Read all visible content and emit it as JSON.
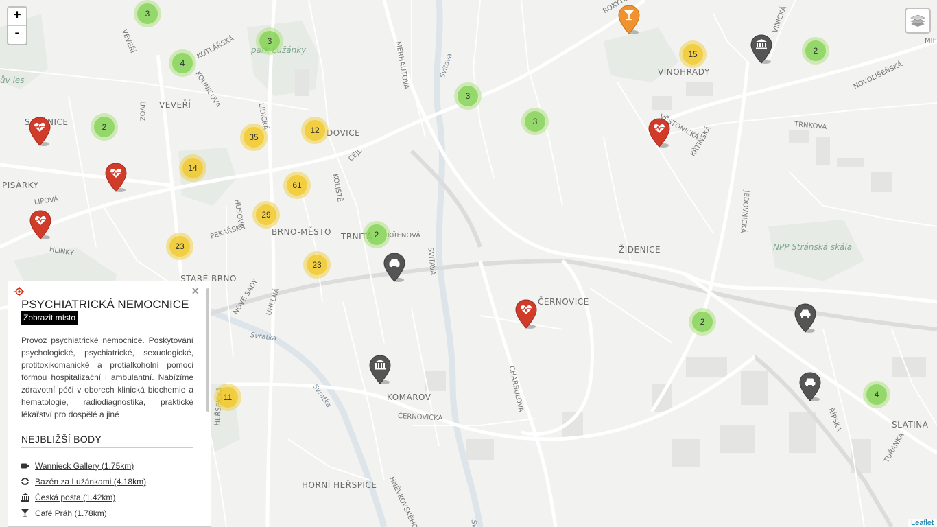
{
  "map": {
    "places": [
      {
        "id": "veveri",
        "text": "VEVEŘÍ"
      },
      {
        "id": "park-luzanky",
        "text": "park Lužánky"
      },
      {
        "id": "vinohrady",
        "text": "VINOHRADY"
      },
      {
        "id": "stranice",
        "text": "STRÁNICE"
      },
      {
        "id": "pisarky",
        "text": "PISÁRKY"
      },
      {
        "id": "brno-mesto",
        "text": "BRNO-MĚSTO"
      },
      {
        "id": "trnita",
        "text": "TRNITÁ"
      },
      {
        "id": "zidenice",
        "text": "ŽIDENICE"
      },
      {
        "id": "npp",
        "text": "NPP Stránská skála"
      },
      {
        "id": "stare-brno",
        "text": "STARÉ BRNO"
      },
      {
        "id": "cernovice",
        "text": "ČERNOVICE"
      },
      {
        "id": "komarov",
        "text": "KOMÁROV"
      },
      {
        "id": "slatina",
        "text": "SLATINA"
      },
      {
        "id": "horni-herspice",
        "text": "HORNÍ HEŘSPICE"
      },
      {
        "id": "zabovresky-fragment",
        "text": "ův les"
      },
      {
        "id": "zidovice-fragment",
        "text": "DOVICE"
      }
    ],
    "streets": [
      {
        "id": "veveri-st",
        "text": "VEVEŘÍ"
      },
      {
        "id": "kotlarska",
        "text": "KOTLÁŘSKÁ"
      },
      {
        "id": "kounicova",
        "text": "KOUNICOVA"
      },
      {
        "id": "udolni",
        "text": "ÚVOZ"
      },
      {
        "id": "lidicka",
        "text": "LIDICKÁ"
      },
      {
        "id": "merhautova",
        "text": "MERHAUTOVA"
      },
      {
        "id": "cejl",
        "text": "CEJL"
      },
      {
        "id": "koliste",
        "text": "KOLIŠTĚ"
      },
      {
        "id": "husova",
        "text": "HUSOVA"
      },
      {
        "id": "pekarska",
        "text": "PEKAŘSKÁ"
      },
      {
        "id": "lipova",
        "text": "LIPOVÁ"
      },
      {
        "id": "hlinky",
        "text": "HLINKY"
      },
      {
        "id": "krenova",
        "text": "KŘENOVÁ"
      },
      {
        "id": "uhelna",
        "text": "UHELNÁ"
      },
      {
        "id": "nove-sady",
        "text": "NOVÉ SADY"
      },
      {
        "id": "vestonicka",
        "text": "VĚSTONICKÁ"
      },
      {
        "id": "krtinska",
        "text": "KŘTINSKÁ"
      },
      {
        "id": "trnkova",
        "text": "TRNKOVA"
      },
      {
        "id": "jedovnicka",
        "text": "JEDOVNICKÁ"
      },
      {
        "id": "novolisenska",
        "text": "NOVOLÍŠEŇSKÁ"
      },
      {
        "id": "charbulova",
        "text": "CHARBULOVA"
      },
      {
        "id": "cernovicka",
        "text": "ČERNOVICKÁ"
      },
      {
        "id": "ripska",
        "text": "ŘÍPSKÁ"
      },
      {
        "id": "turanka",
        "text": "TUŘANKA"
      },
      {
        "id": "herspicka",
        "text": "HEŘSPICKÁ"
      },
      {
        "id": "hnevkovskeho",
        "text": "HNĚVKOVSKÉHO"
      },
      {
        "id": "rokytova",
        "text": "ROKYTOVA"
      },
      {
        "id": "vinohradska-fragment",
        "text": "VINICKÁ"
      },
      {
        "id": "mif-fragment",
        "text": "MIF"
      },
      {
        "id": "vranovska",
        "text": "SVITAVA"
      }
    ],
    "rivers": [
      {
        "id": "svitava-1",
        "text": "Svitava"
      },
      {
        "id": "svitava-2",
        "text": "Svitava"
      },
      {
        "id": "svratka-1",
        "text": "Svratka"
      },
      {
        "id": "svratka-2",
        "text": "Svratka"
      }
    ],
    "clusters": [
      {
        "count": "3",
        "size": "small"
      },
      {
        "count": "3",
        "size": "small"
      },
      {
        "count": "4",
        "size": "small"
      },
      {
        "count": "15",
        "size": "medium"
      },
      {
        "count": "2",
        "size": "small"
      },
      {
        "count": "3",
        "size": "small"
      },
      {
        "count": "3",
        "size": "small"
      },
      {
        "count": "2",
        "size": "small"
      },
      {
        "count": "35",
        "size": "medium"
      },
      {
        "count": "12",
        "size": "medium"
      },
      {
        "count": "14",
        "size": "medium"
      },
      {
        "count": "61",
        "size": "medium"
      },
      {
        "count": "29",
        "size": "medium"
      },
      {
        "count": "2",
        "size": "small"
      },
      {
        "count": "23",
        "size": "medium"
      },
      {
        "count": "23",
        "size": "medium"
      },
      {
        "count": "2",
        "size": "small"
      },
      {
        "count": "4",
        "size": "small"
      },
      {
        "count": "11",
        "size": "medium"
      }
    ],
    "markers": [
      {
        "type": "hospital",
        "color": "#d03b2a",
        "icon": "heartbeat-icon"
      },
      {
        "type": "hospital",
        "color": "#d03b2a",
        "icon": "heartbeat-icon"
      },
      {
        "type": "hospital",
        "color": "#d03b2a",
        "icon": "heartbeat-icon"
      },
      {
        "type": "hospital",
        "color": "#d03b2a",
        "icon": "heartbeat-icon"
      },
      {
        "type": "hospital",
        "color": "#d03b2a",
        "icon": "heartbeat-icon"
      },
      {
        "type": "bar",
        "color": "#f0932f",
        "icon": "cocktail-icon"
      },
      {
        "type": "post",
        "color": "#555555",
        "icon": "bank-icon"
      },
      {
        "type": "post",
        "color": "#555555",
        "icon": "bank-icon"
      },
      {
        "type": "car",
        "color": "#555555",
        "icon": "car-icon"
      },
      {
        "type": "car",
        "color": "#555555",
        "icon": "car-icon"
      },
      {
        "type": "car",
        "color": "#555555",
        "icon": "car-icon"
      }
    ]
  },
  "controls": {
    "zoom_in": "+",
    "zoom_out": "-",
    "attribution": "Leaflet"
  },
  "panel": {
    "title": "PSYCHIATRICKÁ NEMOCNICE BRNO",
    "tooltip": "Zobrazit místo",
    "description": "Provoz psychiatrické nemocnice. Poskytování psychologické, psychiatrické, sexuologické, protitoxikomanické a protialkoholní pomoci formou hospitalizační i ambulantní. Nabízíme zdravotní péči v oborech klinická biochemie a hematologie, radiodiagnostika, praktické lékařství pro dospělé a jiné",
    "nearest_heading": "NEJBLIŽŠÍ BODY",
    "nearest": [
      {
        "label": "Wannieck Gallery (1.75km)",
        "icon": "video-camera-icon"
      },
      {
        "label": "Bazén za Lužánkami (4.18km)",
        "icon": "life-ring-icon"
      },
      {
        "label": "Česká pošta (1.42km)",
        "icon": "bank-icon"
      },
      {
        "label": "Café Práh (1.78km)",
        "icon": "cocktail-icon"
      }
    ]
  },
  "colors": {
    "hospital": "#d03b2a",
    "bar": "#f0932f",
    "dark_marker": "#555555",
    "cluster_small": "#6ecc39",
    "cluster_medium": "#f0c20c",
    "map_bg": "#f2f2f1"
  }
}
